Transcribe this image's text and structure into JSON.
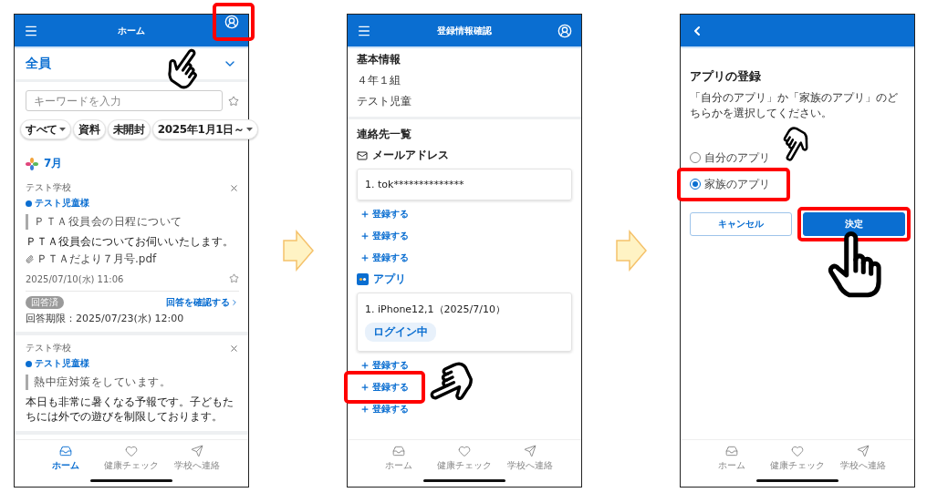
{
  "home_screen": {
    "header": {
      "title": "ホーム",
      "account_highlighted": true
    },
    "audience": "全員",
    "search": {
      "placeholder": "キーワードを入力"
    },
    "filters": [
      {
        "label": "すべて",
        "dropdown": true
      },
      {
        "label": "資料",
        "dropdown": false
      },
      {
        "label": "未開封",
        "dropdown": false
      },
      {
        "label": "2025年1月1日～",
        "dropdown": true
      }
    ],
    "month": "7月",
    "posts": [
      {
        "school": "テスト学校",
        "recipient": "テスト児童様",
        "title": "ＰＴＡ役員会の日程について",
        "body": "ＰＴＡ役員会についてお伺いいたします。",
        "attachment": "ＰＴＡだより７月号.pdf",
        "date": "2025/07/10(水) 11:06",
        "badge": "回答済",
        "deadline": "回答期限：2025/07/23(水) 12:00",
        "link": "回答を確認する"
      },
      {
        "school": "テスト学校",
        "recipient": "テスト児童様",
        "title": "熱中症対策をしています。",
        "body": "本日も非常に暑くなる予報です。子どもたちには外での遊びを制限しております。"
      }
    ],
    "bottom_nav": [
      {
        "label": "ホーム",
        "selected": true
      },
      {
        "label": "健康チェック",
        "selected": false
      },
      {
        "label": "学校へ連絡",
        "selected": false
      }
    ]
  },
  "registration_screen": {
    "header": {
      "title": "登録情報確認"
    },
    "basic_info": {
      "heading": "基本情報",
      "lines": [
        "４年１組",
        "テスト児童"
      ]
    },
    "contacts_heading": "連絡先一覧",
    "sections": [
      {
        "kind": "mail",
        "heading": "メールアドレス",
        "entries": [
          {
            "text": "1. tok**************"
          }
        ],
        "add_buttons": [
          {
            "label": "登録する",
            "highlighted": false
          },
          {
            "label": "登録する",
            "highlighted": false
          },
          {
            "label": "登録する",
            "highlighted": false
          }
        ]
      },
      {
        "kind": "app",
        "heading": "アプリ",
        "entries": [
          {
            "text": "1. iPhone12,1（2025/7/10）",
            "tags": [
              "ログイン中"
            ]
          }
        ],
        "add_buttons": [
          {
            "label": "登録する",
            "highlighted": false
          },
          {
            "label": "登録する",
            "highlighted": true
          },
          {
            "label": "登録する",
            "highlighted": false
          }
        ]
      }
    ],
    "bottom_nav": [
      {
        "label": "ホーム",
        "selected": false
      },
      {
        "label": "健康チェック",
        "selected": false
      },
      {
        "label": "学校へ連絡",
        "selected": false
      }
    ]
  },
  "app_screen": {
    "title": "アプリの登録",
    "description": "「自分のアプリ」か「家族のアプリ」のどちらかを選択してください。",
    "options": [
      {
        "label": "自分のアプリ",
        "selected": false,
        "highlighted": false
      },
      {
        "label": "家族のアプリ",
        "selected": true,
        "highlighted": true
      }
    ],
    "buttons": [
      {
        "kind": "cancel",
        "label": "キャンセル",
        "highlighted": false
      },
      {
        "kind": "confirm",
        "label": "決定",
        "highlighted": true
      }
    ],
    "bottom_nav": [
      {
        "label": "ホーム",
        "selected": false
      },
      {
        "label": "健康チェック",
        "selected": false
      },
      {
        "label": "学校へ連絡",
        "selected": false
      }
    ]
  }
}
